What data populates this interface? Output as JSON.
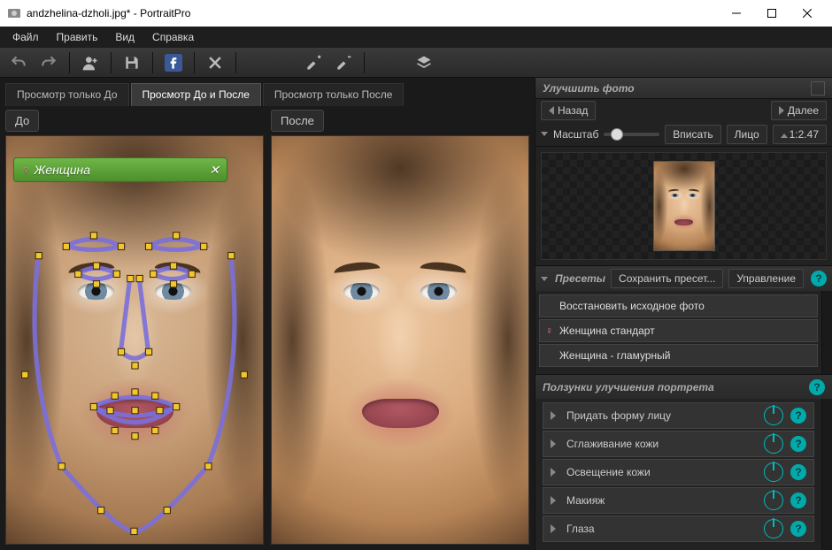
{
  "window": {
    "title": "andzhelina-dzholi.jpg* - PortraitPro"
  },
  "menu": {
    "file": "Файл",
    "edit": "Править",
    "view": "Вид",
    "help": "Справка"
  },
  "tabs": {
    "before_only": "Просмотр только До",
    "before_after": "Просмотр До и После",
    "after_only": "Просмотр только После"
  },
  "panes": {
    "before": "До",
    "after": "После",
    "gender_label": "Женщина"
  },
  "panel": {
    "title": "Улучшить фото",
    "back": "Назад",
    "next": "Далее",
    "zoom_label": "Масштаб",
    "fit": "Вписать",
    "face": "Лицо",
    "ratio": "1:2.47",
    "presets_title": "Пресеты",
    "save_preset": "Сохранить пресет...",
    "manage": "Управление",
    "presets": [
      "Восстановить исходное фото",
      "Женщина стандарт",
      "Женщина - гламурный"
    ],
    "sliders_title": "Ползунки улучшения портрета",
    "sliders": [
      "Придать форму лицу",
      "Сглаживание кожи",
      "Освещение кожи",
      "Макияж",
      "Глаза"
    ]
  }
}
